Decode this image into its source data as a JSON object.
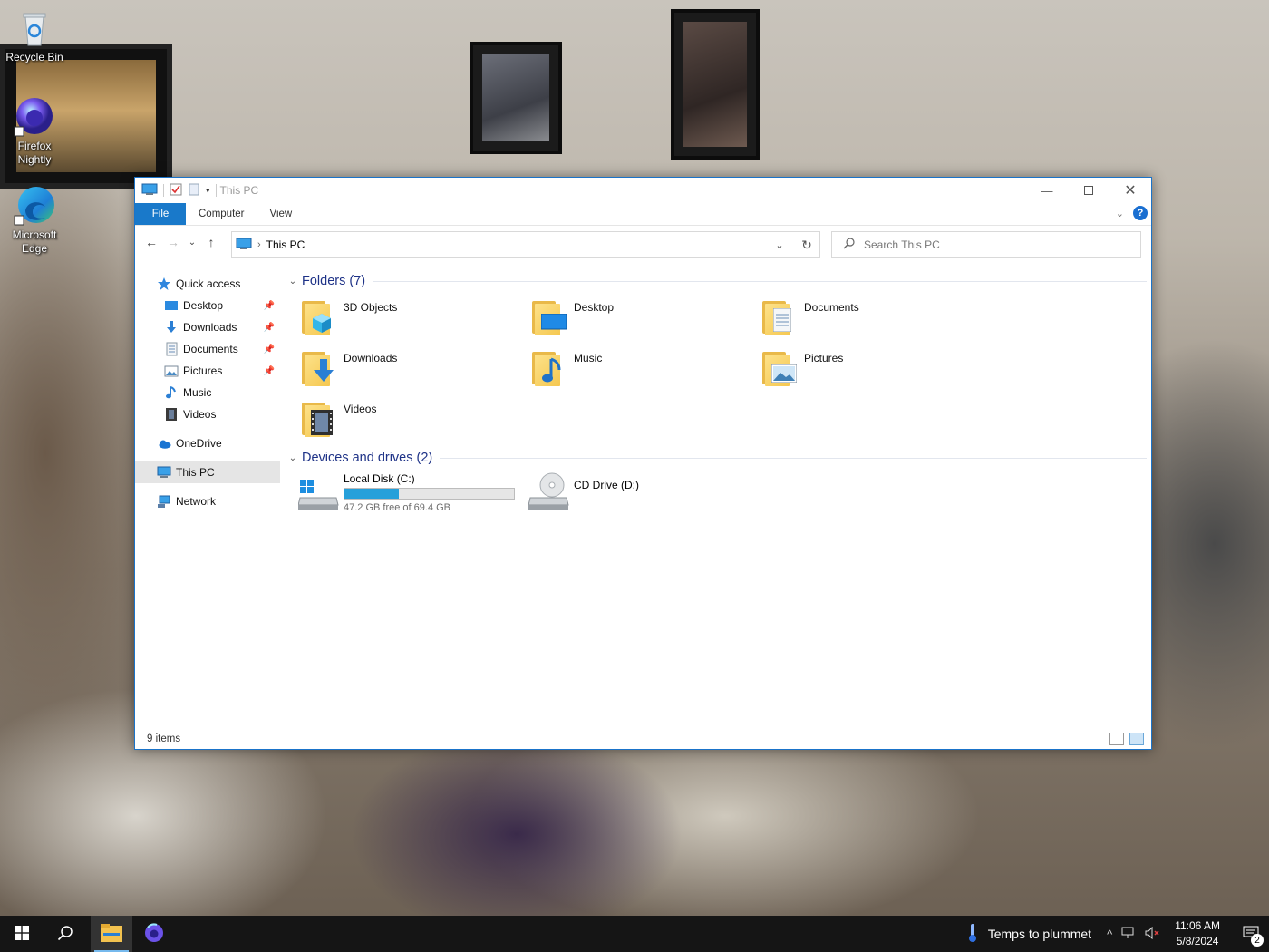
{
  "desktop": {
    "icons": [
      {
        "label": "Recycle Bin"
      },
      {
        "label": "Firefox Nightly"
      },
      {
        "label": "Microsoft Edge"
      }
    ]
  },
  "window": {
    "title": "This PC",
    "ribbon_tabs": [
      "File",
      "Computer",
      "View"
    ],
    "address": {
      "location": "This PC"
    },
    "search": {
      "placeholder": "Search This PC"
    },
    "nav_pane": {
      "quick_access": "Quick access",
      "quick_items": [
        "Desktop",
        "Downloads",
        "Documents",
        "Pictures",
        "Music",
        "Videos"
      ],
      "onedrive": "OneDrive",
      "this_pc": "This PC",
      "network": "Network"
    },
    "folders_header": "Folders (7)",
    "folders": [
      "3D Objects",
      "Desktop",
      "Documents",
      "Downloads",
      "Music",
      "Pictures",
      "Videos"
    ],
    "drives_header": "Devices and drives (2)",
    "drives": [
      {
        "name": "Local Disk (C:)",
        "free": "47.2 GB free of 69.4 GB",
        "used_fraction": 0.32
      },
      {
        "name": "CD Drive (D:)"
      }
    ],
    "status": "9 items"
  },
  "taskbar": {
    "weather_text": "Temps to plummet",
    "time": "11:06 AM",
    "date": "5/8/2024",
    "notification_count": "2"
  },
  "colors": {
    "accent": "#1979ca",
    "progress": "#26a0da",
    "group_header": "#1e3287"
  }
}
